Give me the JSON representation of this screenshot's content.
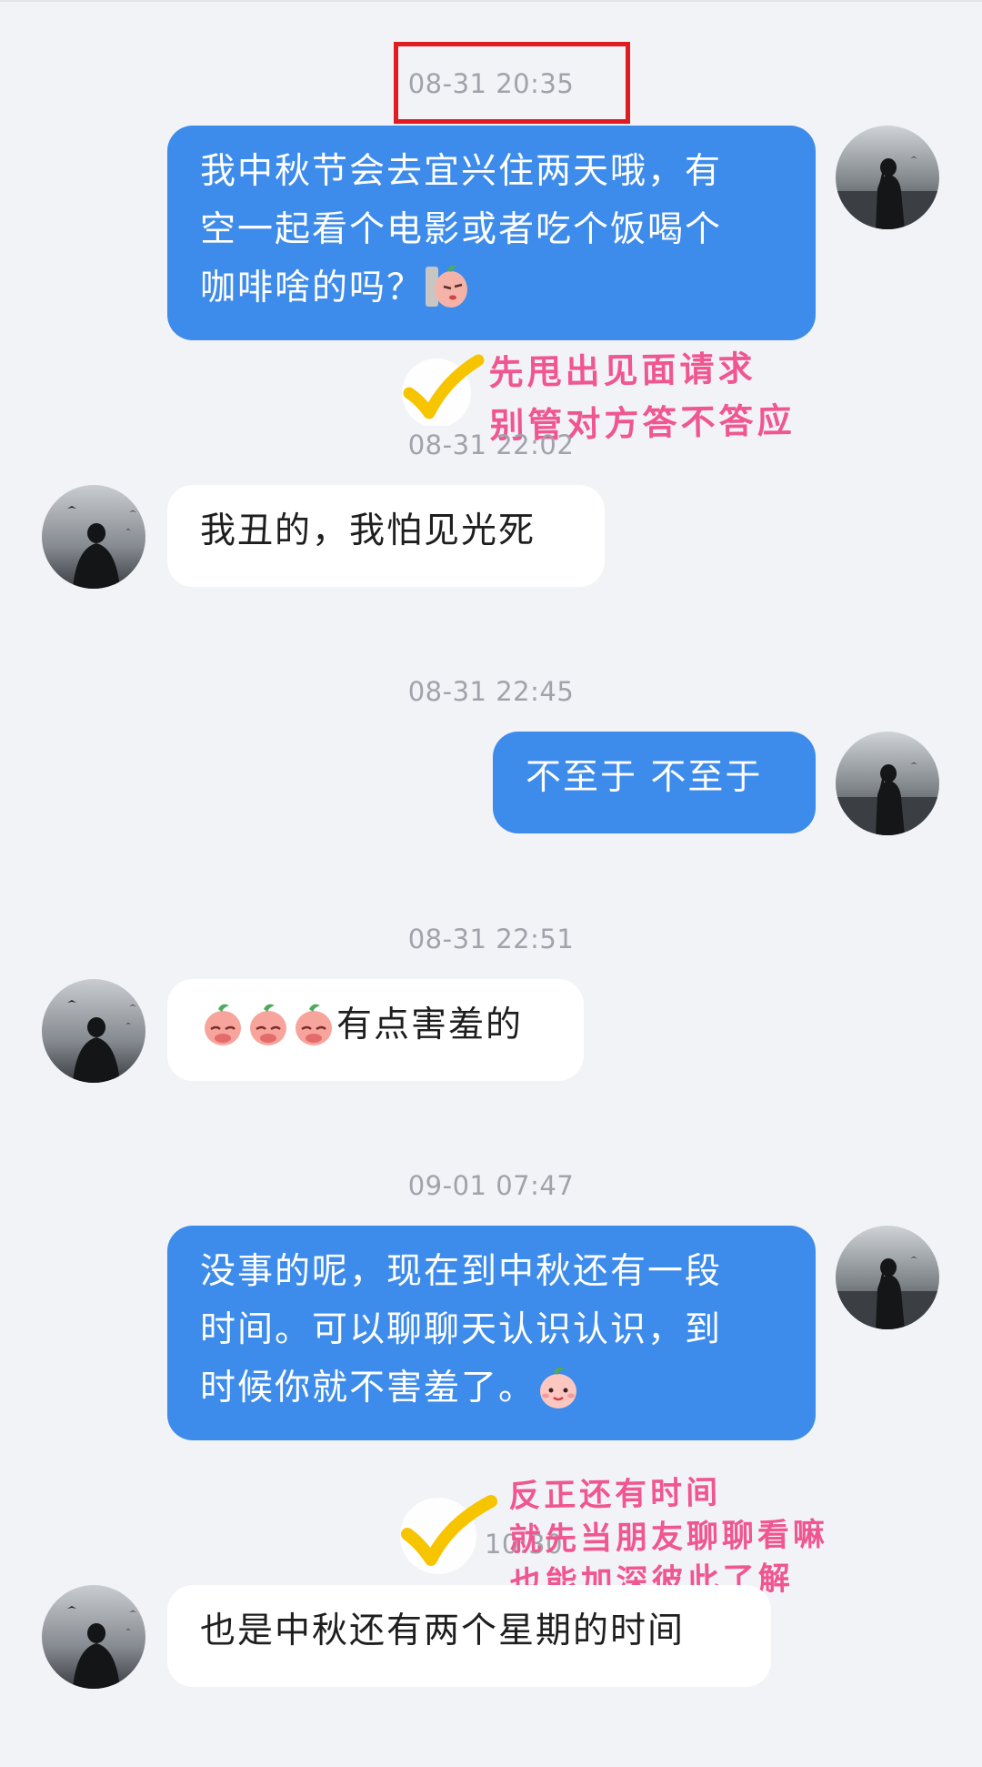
{
  "timestamps": [
    "08-31 20:35",
    "08-31 22:02",
    "08-31 22:45",
    "08-31 22:51",
    "09-01 07:47",
    "10:30"
  ],
  "messages": {
    "m1_line1": "我中秋节会去宜兴住两天哦，有",
    "m1_line2": "空一起看个电影或者吃个饭喝个",
    "m1_line3": "咖啡啥的吗？",
    "m2": "我丑的，我怕见光死",
    "m3": "不至于 不至于",
    "m4": "有点害羞的",
    "m5_line1": "没事的呢，现在到中秋还有一段",
    "m5_line2": "时间。可以聊聊天认识认识，到",
    "m5_line3": "时候你就不害羞了。",
    "m6": "也是中秋还有两个星期的时间"
  },
  "annotations": {
    "a1_line1": "先甩出见面请求",
    "a1_line2": "别管对方答不答应",
    "a2_line1": "反正还有时间",
    "a2_line2": "就先当朋友聊聊看嘛",
    "a2_line3": "也能加深彼此了解"
  },
  "colors": {
    "outgoing_bubble": "#3d8bea",
    "incoming_bubble": "#ffffff",
    "background": "#f2f3f7",
    "timestamp_text": "#a0a3aa",
    "highlight_box": "#e11b22",
    "annotation_text": "#f0568f",
    "checkmark": "#f7c400"
  },
  "icons": {
    "my_avatar": "woman-silhouette-by-sea-avatar",
    "their_avatar": "man-silhouette-with-birds-avatar",
    "sticker": "peach-sticker-emoji",
    "annotation_mark": "yellow-checkmark-icon"
  }
}
